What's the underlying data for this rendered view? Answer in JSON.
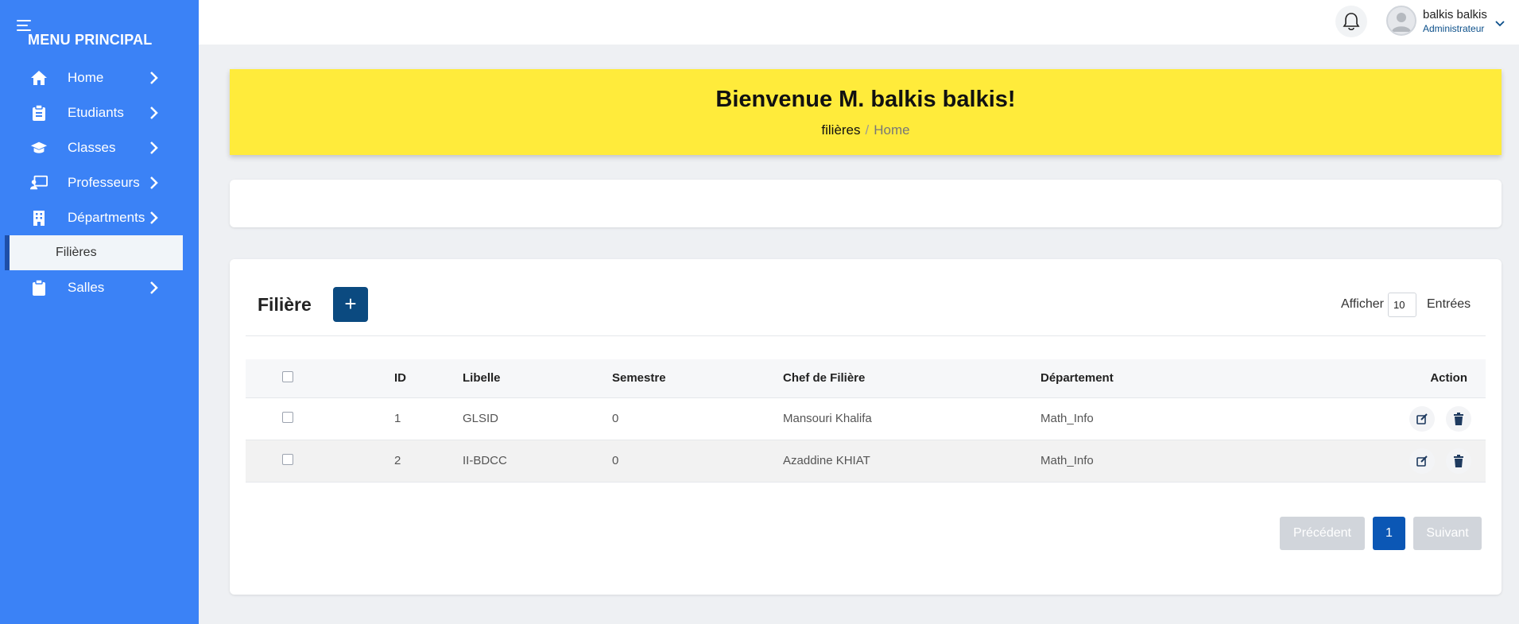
{
  "sidebar": {
    "title": "MENU PRINCIPAL",
    "items": [
      {
        "label": "Home",
        "icon": "home-icon"
      },
      {
        "label": "Etudiants",
        "icon": "clipboard-icon"
      },
      {
        "label": "Classes",
        "icon": "graduation-cap-icon"
      },
      {
        "label": "Professeurs",
        "icon": "chalkboard-teacher-icon"
      },
      {
        "label": "Départments",
        "icon": "building-icon"
      },
      {
        "label": "Filières",
        "icon": ""
      },
      {
        "label": "Salles",
        "icon": "clipboard-icon"
      }
    ]
  },
  "topbar": {
    "user_name": "balkis balkis",
    "user_role": "Administrateur"
  },
  "banner": {
    "title": "Bienvenue M. balkis balkis!",
    "breadcrumb_current": "filières",
    "breadcrumb_separator": "/",
    "breadcrumb_home": "Home"
  },
  "table_card": {
    "title": "Filière",
    "add_label": "+",
    "show_label": "Afficher",
    "entries_value": "10",
    "entries_label": "Entrées",
    "columns": [
      "ID",
      "Libelle",
      "Semestre",
      "Chef de Filière",
      "Département",
      "Action"
    ],
    "rows": [
      {
        "id": "1",
        "libelle": "GLSID",
        "semestre": "0",
        "chef": "Mansouri Khalifa",
        "departement": "Math_Info"
      },
      {
        "id": "2",
        "libelle": "II-BDCC",
        "semestre": "0",
        "chef": "Azaddine KHIAT",
        "departement": "Math_Info"
      }
    ],
    "pagination": {
      "prev": "Précédent",
      "page": "1",
      "next": "Suivant"
    }
  },
  "colors": {
    "sidebar": "#3b82f6",
    "banner": "#ffeb3b",
    "primary_button": "#0b4a80",
    "active_page": "#0b57b5"
  }
}
